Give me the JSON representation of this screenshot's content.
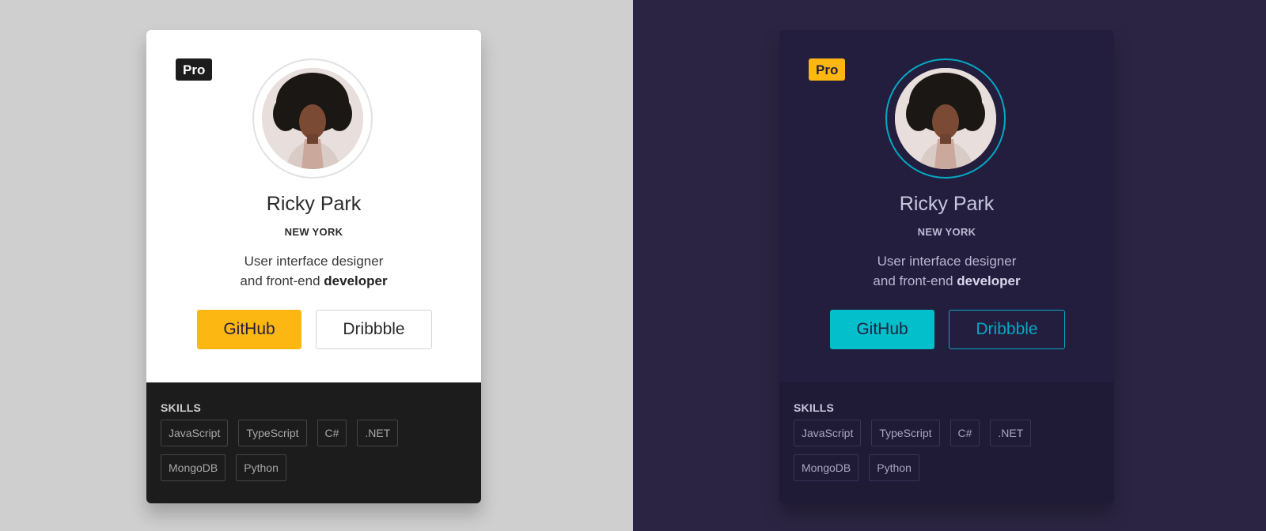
{
  "cards": [
    {
      "theme": "light",
      "badge": "Pro",
      "name": "Ricky Park",
      "city": "NEW YORK",
      "bio_line1": "User interface designer",
      "bio_line2_prefix": "and front-end",
      "bio_line2_bold": "developer",
      "primary_button": "GitHub",
      "secondary_button": "Dribbble",
      "skills_title": "SKILLS",
      "skills": [
        "JavaScript",
        "TypeScript",
        "C#",
        ".NET",
        "MongoDB",
        "Python"
      ],
      "colors": {
        "background": "#cfcfcf",
        "card": "#ffffff",
        "accent": "#fcb713",
        "skills_bg": "#1c1c1c"
      }
    },
    {
      "theme": "dark",
      "badge": "Pro",
      "name": "Ricky Park",
      "city": "NEW YORK",
      "bio_line1": "User interface designer",
      "bio_line2_prefix": "and front-end",
      "bio_line2_bold": "developer",
      "primary_button": "GitHub",
      "secondary_button": "Dribbble",
      "skills_title": "SKILLS",
      "skills": [
        "JavaScript",
        "TypeScript",
        "C#",
        ".NET",
        "MongoDB",
        "Python"
      ],
      "colors": {
        "background": "#2b2543",
        "card": "#231e3d",
        "accent": "#03bfcb",
        "skills_bg": "#1f1a36"
      }
    }
  ]
}
